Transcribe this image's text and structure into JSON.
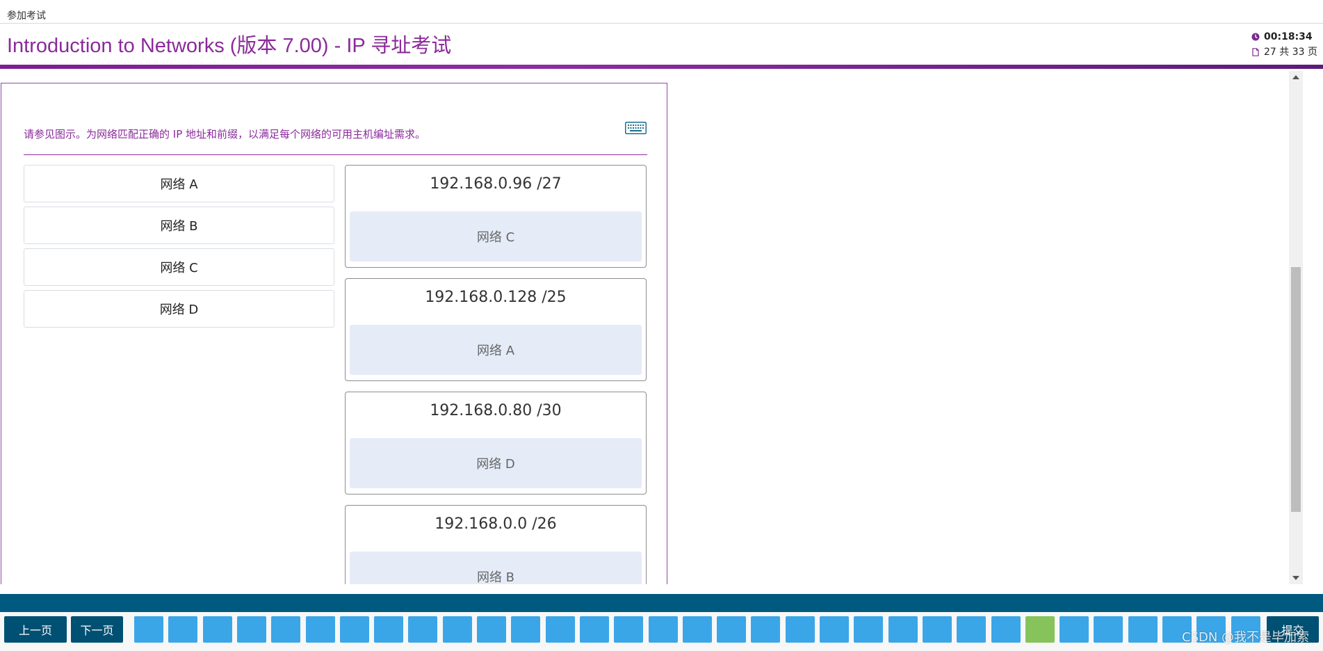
{
  "topbar": {
    "label": "参加考试"
  },
  "header": {
    "title": "Introduction to Networks (版本 7.00) - IP 寻址考试",
    "timer": "00:18:34",
    "page_status": "27 共 33 页"
  },
  "question": {
    "prompt": "请参见图示。为网络匹配正确的 IP 地址和前缀，以满足每个网络的可用主机编址需求。",
    "options": [
      {
        "label": "网络 A"
      },
      {
        "label": "网络 B"
      },
      {
        "label": "网络 C"
      },
      {
        "label": "网络 D"
      }
    ],
    "targets": [
      {
        "ip": "192.168.0.96 /27",
        "answer": "网络 C"
      },
      {
        "ip": "192.168.0.128 /25",
        "answer": "网络 A"
      },
      {
        "ip": "192.168.0.80 /30",
        "answer": "网络 D"
      },
      {
        "ip": "192.168.0.0 /26",
        "answer": "网络 B"
      }
    ]
  },
  "footer": {
    "prev_label": "上一页",
    "next_label": "下一页",
    "submit_label": "提交",
    "page_count": 33,
    "current_page": 27,
    "watermark": "CSDN @我不是毕加索"
  },
  "colors": {
    "accent": "#8b2a9b",
    "nav": "#005073",
    "page_button": "#3aa6e8",
    "current_page_button": "#86c35a",
    "drop_zone": "#e5ecf7"
  }
}
